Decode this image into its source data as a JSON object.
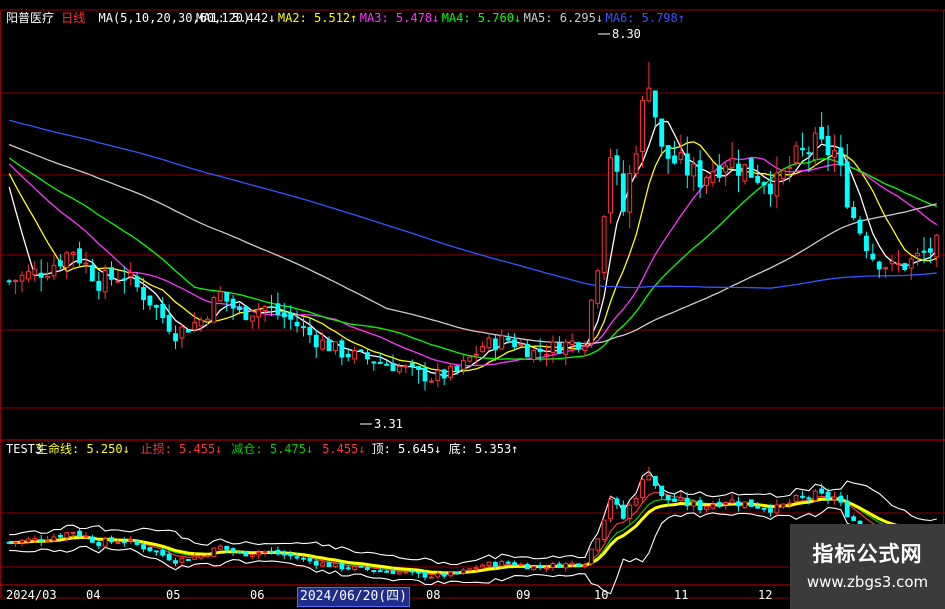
{
  "window": {
    "title": "阳普医疗 日线"
  },
  "header": {
    "stock": "阳普医疗",
    "period": "日线",
    "ma_label": "MA(5,10,20,30,60,120)",
    "ma": [
      {
        "name": "MA1",
        "value": "5.442",
        "dir": "↓",
        "color": "#ffffff"
      },
      {
        "name": "MA2",
        "value": "5.512",
        "dir": "↑",
        "color": "#ffff00"
      },
      {
        "name": "MA3",
        "value": "5.478",
        "dir": "↓",
        "color": "#ff33ff"
      },
      {
        "name": "MA4",
        "value": "5.760",
        "dir": "↓",
        "color": "#00ff00"
      },
      {
        "name": "MA5",
        "value": "6.295",
        "dir": "↓",
        "color": "#cccccc"
      },
      {
        "name": "MA6",
        "value": "5.798",
        "dir": "↑",
        "color": "#3355ff"
      }
    ]
  },
  "sub_header": {
    "name": "TEST3",
    "items": [
      {
        "label": "生命线",
        "value": "5.250",
        "dir": "↓",
        "color": "#ffff00"
      },
      {
        "label": "止损",
        "value": "5.455",
        "dir": "↓",
        "color": "#ff3333"
      },
      {
        "label": "减仓",
        "value": "5.475",
        "dir": "↓",
        "color": "#00cc00"
      },
      {
        "label": "",
        "value": "5.455",
        "dir": "↓",
        "color": "#ff3333"
      },
      {
        "label": "顶",
        "value": "5.645",
        "dir": "↓",
        "color": "#ffffff"
      },
      {
        "label": "底",
        "value": "5.353",
        "dir": "↑",
        "color": "#ffffff"
      }
    ]
  },
  "annotations": {
    "high": "8.30",
    "low": "3.31"
  },
  "x_labels": [
    "2024/03",
    "04",
    "05",
    "06",
    "07",
    "08",
    "09",
    "10",
    "11",
    "12"
  ],
  "date_box": "2024/06/20(四)",
  "colors": {
    "up": "#ff3333",
    "down": "#00ffff",
    "grid": "#8b0000"
  },
  "chart_data": {
    "type": "candlestick",
    "price_ylim": [
      2.5,
      8.8
    ],
    "months": [
      "2024/03",
      "04",
      "05",
      "06",
      "07",
      "08",
      "09",
      "10",
      "11",
      "12"
    ],
    "close_path": [
      [
        0,
        4.9
      ],
      [
        6,
        5.1
      ],
      [
        10,
        5.4
      ],
      [
        14,
        4.9
      ],
      [
        18,
        5.0
      ],
      [
        22,
        4.6
      ],
      [
        26,
        4.1
      ],
      [
        30,
        4.3
      ],
      [
        33,
        4.7
      ],
      [
        36,
        4.4
      ],
      [
        40,
        4.5
      ],
      [
        44,
        4.3
      ],
      [
        48,
        4.0
      ],
      [
        52,
        3.8
      ],
      [
        56,
        3.7
      ],
      [
        60,
        3.6
      ],
      [
        63,
        3.5
      ],
      [
        66,
        3.4
      ],
      [
        70,
        3.5
      ],
      [
        74,
        3.9
      ],
      [
        78,
        4.0
      ],
      [
        82,
        3.8
      ],
      [
        86,
        3.9
      ],
      [
        90,
        4.0
      ],
      [
        92,
        5.2
      ],
      [
        94,
        6.9
      ],
      [
        96,
        6.0
      ],
      [
        100,
        8.1
      ],
      [
        102,
        6.9
      ],
      [
        105,
        6.7
      ],
      [
        108,
        6.5
      ],
      [
        112,
        6.8
      ],
      [
        116,
        6.6
      ],
      [
        120,
        6.4
      ],
      [
        123,
        6.8
      ],
      [
        126,
        7.0
      ],
      [
        129,
        6.9
      ],
      [
        132,
        5.9
      ],
      [
        135,
        5.3
      ],
      [
        138,
        5.1
      ],
      [
        141,
        5.2
      ],
      [
        145,
        5.45
      ]
    ],
    "ma_series": [
      {
        "name": "MA1",
        "color": "#ffffff",
        "window": 5
      },
      {
        "name": "MA2",
        "color": "#ffff00",
        "window": 10
      },
      {
        "name": "MA3",
        "color": "#ff33ff",
        "window": 20
      },
      {
        "name": "MA4",
        "color": "#00ff00",
        "window": 30
      },
      {
        "name": "MA5",
        "color": "#cccccc",
        "window": 60
      },
      {
        "name": "MA6",
        "color": "#3355ff",
        "window": 120
      }
    ],
    "high": 8.3,
    "low": 3.31,
    "sub_ylim": [
      3.0,
      8.5
    ],
    "sub_series": [
      {
        "name": "生命线",
        "color": "#ffff00"
      },
      {
        "name": "止损",
        "color": "#ff3333"
      },
      {
        "name": "减仓",
        "color": "#00cc00"
      },
      {
        "name": "顶",
        "color": "#ffffff"
      },
      {
        "name": "底",
        "color": "#ffffff"
      }
    ]
  }
}
